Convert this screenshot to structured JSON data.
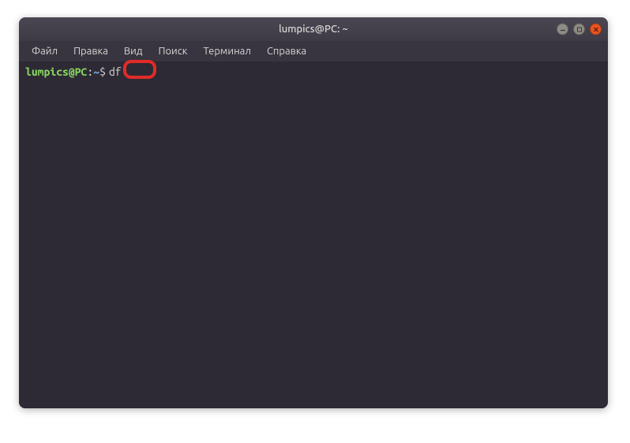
{
  "window": {
    "title": "lumpics@PC: ~"
  },
  "menubar": {
    "items": [
      {
        "label": "Файл"
      },
      {
        "label": "Правка"
      },
      {
        "label": "Вид"
      },
      {
        "label": "Поиск"
      },
      {
        "label": "Терминал"
      },
      {
        "label": "Справка"
      }
    ]
  },
  "terminal": {
    "prompt_user": "lumpics@PC",
    "prompt_colon": ":",
    "prompt_path": "~",
    "prompt_dollar": "$",
    "command": "df"
  }
}
